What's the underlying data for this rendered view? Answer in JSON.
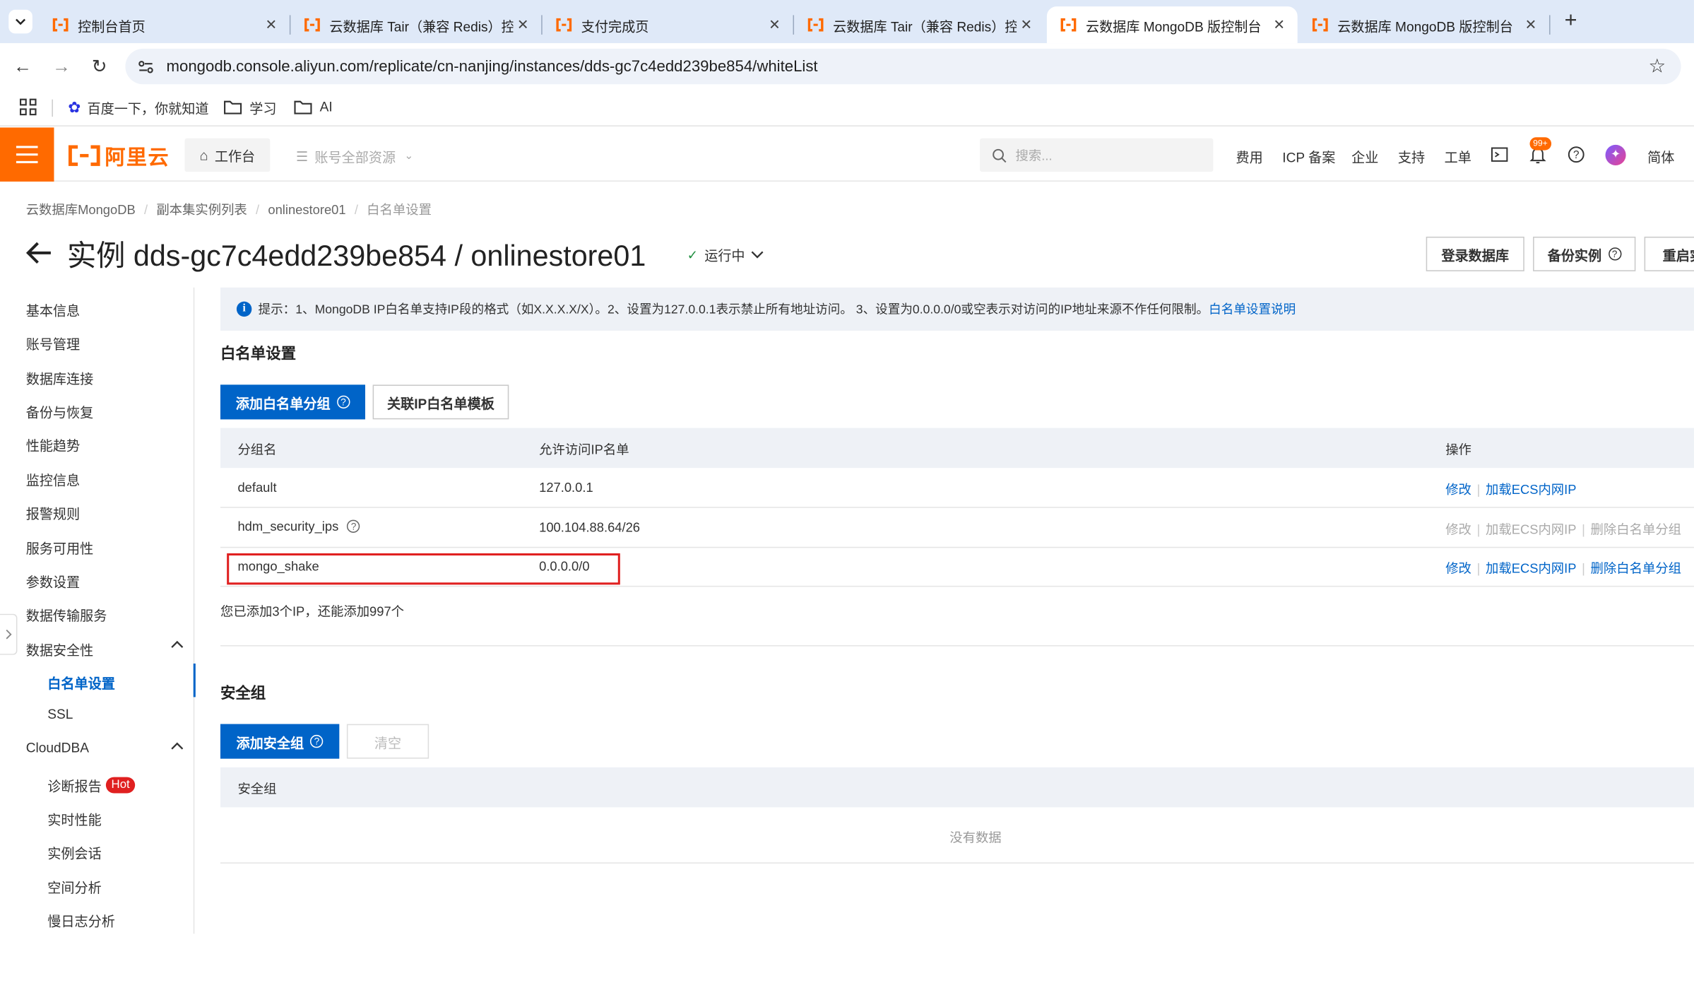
{
  "browser": {
    "tabs": [
      {
        "title": "控制台首页",
        "active": false
      },
      {
        "title": "云数据库 Tair（兼容 Redis）控",
        "active": false
      },
      {
        "title": "支付完成页",
        "active": false
      },
      {
        "title": "云数据库 Tair（兼容 Redis）控",
        "active": false
      },
      {
        "title": "云数据库 MongoDB 版控制台",
        "active": true
      },
      {
        "title": "云数据库 MongoDB 版控制台",
        "active": false
      }
    ],
    "new_tab": "+",
    "url": "mongodb.console.aliyun.com/replicate/cn-nanjing/instances/dds-gc7c4edd239be854/whiteList",
    "bookmarks": [
      "百度一下，你就知道",
      "学习",
      "AI"
    ]
  },
  "console_header": {
    "logo": "阿里云",
    "workbench": "工作台",
    "resources": "账号全部资源",
    "search_placeholder": "搜索...",
    "links": [
      "费用",
      "ICP 备案",
      "企业",
      "支持",
      "工单"
    ],
    "notification_badge": "99+",
    "lang": "简体"
  },
  "breadcrumb": [
    "云数据库MongoDB",
    "副本集实例列表",
    "onlinestore01",
    "白名单设置"
  ],
  "page": {
    "title": "实例 dds-gc7c4edd239be854 / onlinestore01",
    "status": "运行中",
    "actions": [
      "登录数据库",
      "备份实例",
      "重启实"
    ]
  },
  "sidebar": {
    "items": [
      "基本信息",
      "账号管理",
      "数据库连接",
      "备份与恢复",
      "性能趋势",
      "监控信息",
      "报警规则",
      "服务可用性",
      "参数设置",
      "数据传输服务"
    ],
    "group_security": {
      "label": "数据安全性",
      "children": [
        "白名单设置",
        "SSL"
      ]
    },
    "group_clouddba": {
      "label": "CloudDBA",
      "children": [
        "诊断报告",
        "实时性能",
        "实例会话",
        "空间分析",
        "慢日志分析"
      ]
    },
    "hot_badge": "Hot"
  },
  "whitelist": {
    "tip": "提示：1、MongoDB IP白名单支持IP段的格式（如X.X.X.X/X）。2、设置为127.0.0.1表示禁止所有地址访问。 3、设置为0.0.0.0/0或空表示对访问的IP地址来源不作任何限制。",
    "tip_link": "白名单设置说明",
    "section_title": "白名单设置",
    "add_button": "添加白名单分组",
    "template_button": "关联IP白名单模板",
    "columns": [
      "分组名",
      "允许访问IP名单",
      "操作"
    ],
    "rows": [
      {
        "name": "default",
        "ips": "127.0.0.1",
        "actions": [
          "修改",
          "加载ECS内网IP"
        ],
        "disabled": false
      },
      {
        "name": "hdm_security_ips",
        "ips": "100.104.88.64/26",
        "actions": [
          "修改",
          "加载ECS内网IP",
          "删除白名单分组"
        ],
        "disabled": true
      },
      {
        "name": "mongo_shake",
        "ips": "0.0.0.0/0",
        "actions": [
          "修改",
          "加载ECS内网IP",
          "删除白名单分组"
        ],
        "disabled": false
      }
    ],
    "summary": "您已添加3个IP，还能添加997个"
  },
  "security_group": {
    "section_title": "安全组",
    "add_button": "添加安全组",
    "clear_button": "清空",
    "column": "安全组",
    "empty": "没有数据"
  },
  "colors": {
    "brand": "#ff6a00",
    "primary": "#0064c8",
    "highlight": "#e02020"
  }
}
